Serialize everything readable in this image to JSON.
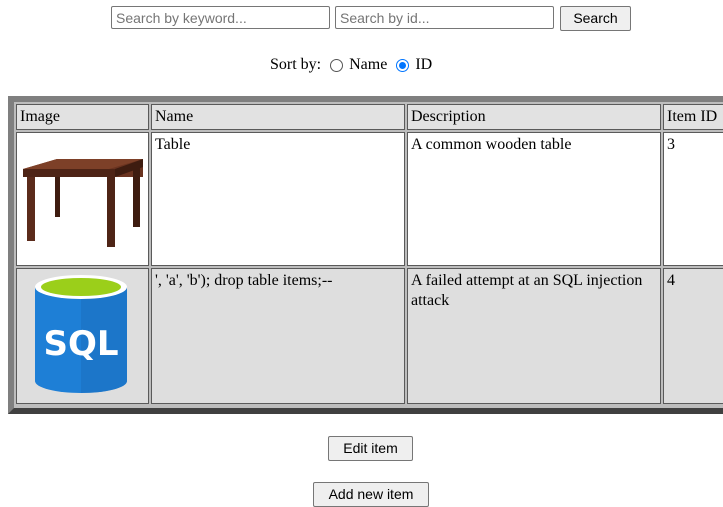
{
  "search": {
    "keyword_placeholder": "Search by keyword...",
    "keyword_value": "",
    "id_placeholder": "Search by id...",
    "id_value": "",
    "button_label": "Search"
  },
  "sort": {
    "label": "Sort by:",
    "options": [
      {
        "label": "Name",
        "selected": false
      },
      {
        "label": "ID",
        "selected": true
      }
    ]
  },
  "table": {
    "headers": [
      "Image",
      "Name",
      "Description",
      "Item ID"
    ],
    "rows": [
      {
        "image_icon": "wooden-table-image",
        "name": "Table",
        "description": "A common wooden table",
        "item_id": "3"
      },
      {
        "image_icon": "sql-database-image",
        "name": "', 'a', 'b'); drop table items;--",
        "description": "A failed attempt at an SQL injection attack",
        "item_id": "4"
      }
    ]
  },
  "actions": {
    "edit_label": "Edit item",
    "add_label": "Add new item"
  },
  "colors": {
    "accent_radio": "#0075ff",
    "sql_blue": "#1e7fd6",
    "sql_lime": "#9bcf1a",
    "table_wood": "#5b2b1b"
  }
}
